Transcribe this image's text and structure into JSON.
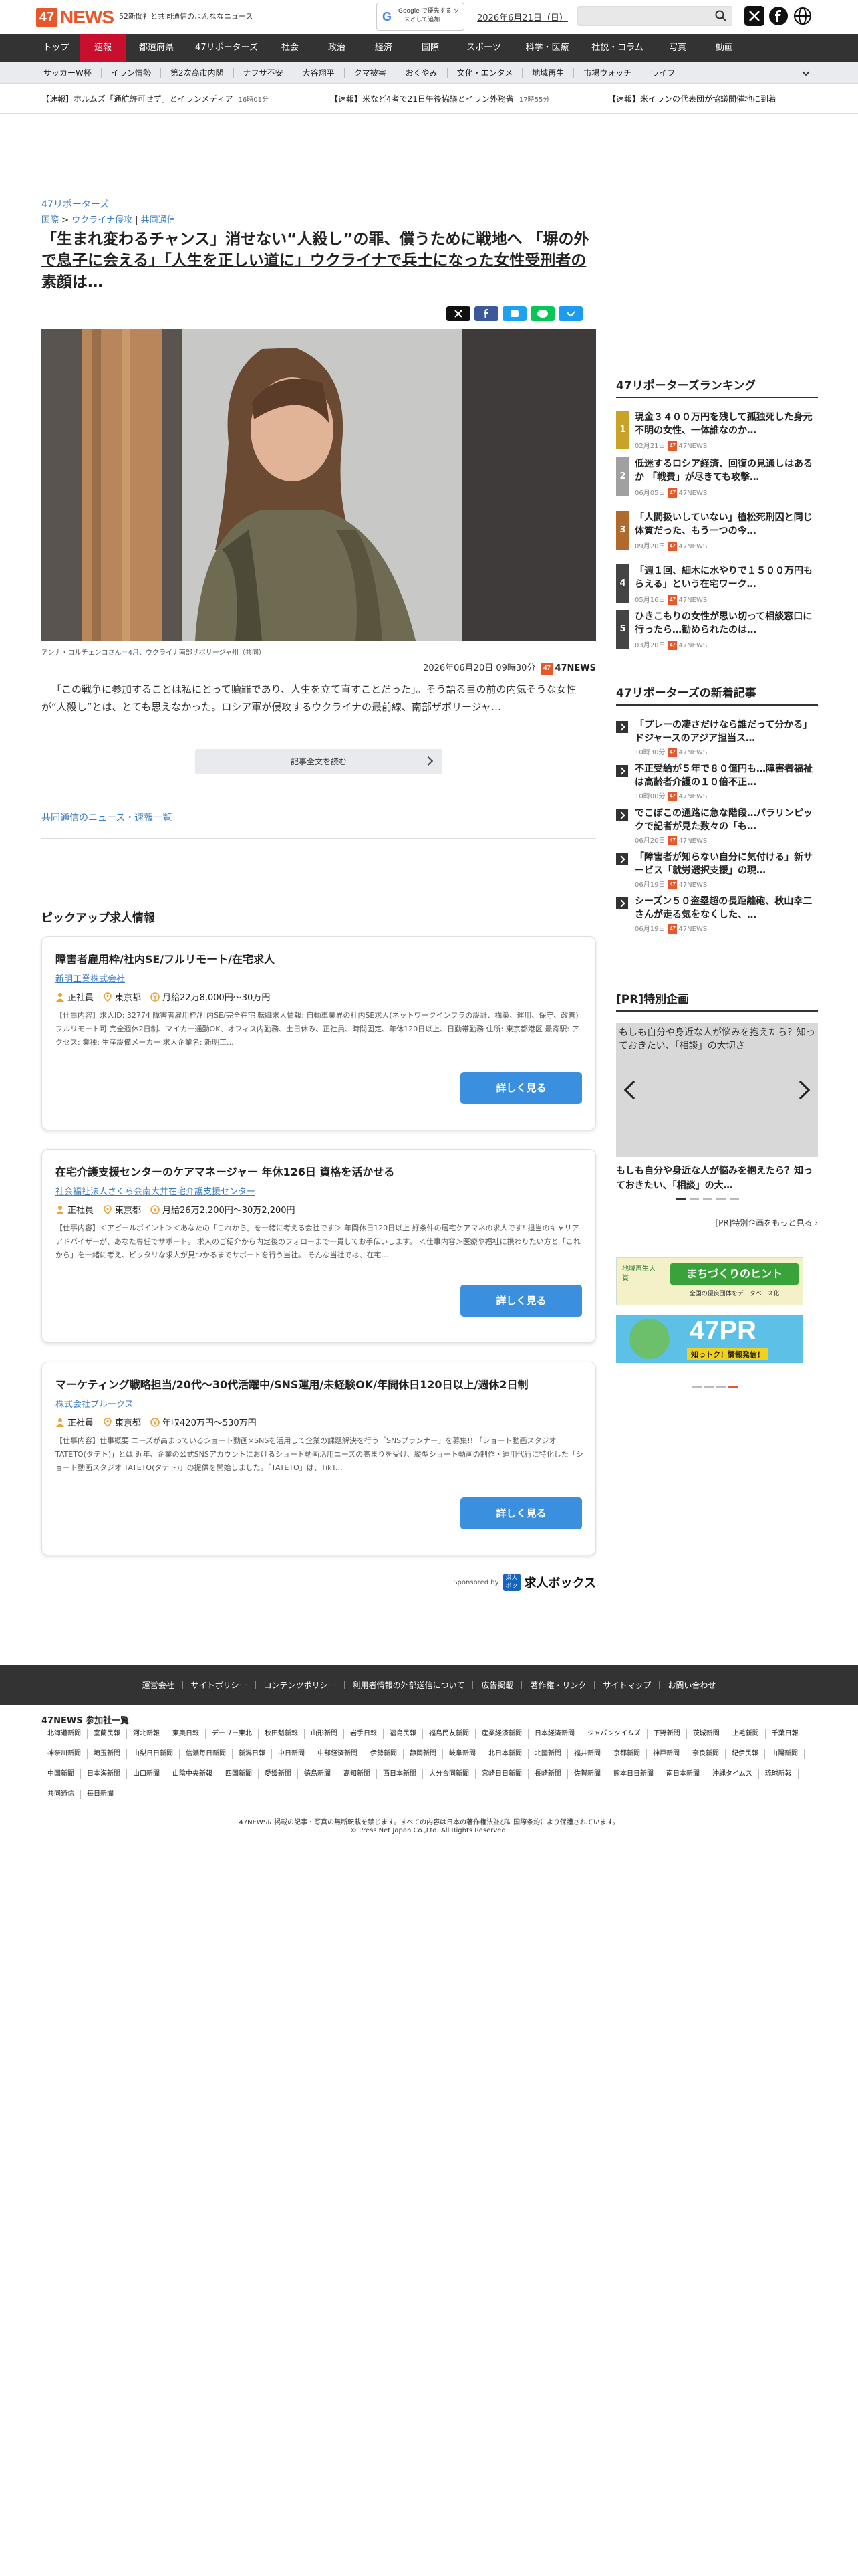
{
  "header": {
    "logo_mark": "47",
    "logo_word": "NEWS",
    "tagline": "52新聞社と共同通信のよんななニュース",
    "google_button": "Google で優先する ソースとして追加",
    "date_link": "2026年6月21日（日）",
    "search_placeholder": ""
  },
  "nav": [
    "トップ",
    "速報",
    "都道府県",
    "47リポーターズ",
    "社会",
    "政治",
    "経済",
    "国際",
    "スポーツ",
    "科学・医療",
    "社説・コラム",
    "写真",
    "動画"
  ],
  "subnav": [
    "サッカーW杯",
    "イラン情勢",
    "第2次高市内閣",
    "ナフサ不安",
    "大谷翔平",
    "クマ被害",
    "おくやみ",
    "文化・エンタメ",
    "地域再生",
    "市場ウォッチ",
    "ライフ"
  ],
  "ticker": [
    {
      "text": "【速報】ホルムズ「通航許可せず」とイランメディア",
      "time": "16時01分"
    },
    {
      "text": "【速報】米など4者で21日午後協議とイラン外務省",
      "time": "17時55分"
    },
    {
      "text": "【速報】米イランの代表団が協議開催地に到着",
      "time": ""
    }
  ],
  "article": {
    "kicker": "47リポーターズ",
    "breadcrumb": [
      "国際",
      "ウクライナ侵攻",
      "共同通信"
    ],
    "headline": "「生まれ変わるチャンス」消せない“人殺し”の罪、償うために戦地へ 「塀の外で息子に会える」「人生を正しい道に」ウクライナで兵士になった女性受刑者の素顔は…",
    "caption": "アンナ・コルチェンコさん＝4月、ウクライナ南部ザポリージャ州（共同）",
    "datetime": "2026年06月20日 09時30分",
    "source_badge": "47",
    "source": "47NEWS",
    "lede": "「この戦争に参加することは私にとって贖罪であり、人生を立て直すことだった」。そう語る目の前の内気そうな女性が“人殺し”とは、とても思えなかった。ロシア軍が侵攻するウクライナの最前線、南部ザポリージャ…",
    "read_more": "記事全文を読む",
    "kyodo_link": "共同通信のニュース・速報一覧"
  },
  "share_colors": [
    "#111111",
    "#3b5998",
    "#1da1f2",
    "#06c755",
    "#1d9bf0"
  ],
  "pickup": {
    "title": "ピックアップ求人情報",
    "jobs": [
      {
        "title": "障害者雇用枠/社内SE/フルリモート/在宅求人",
        "company": "新明工業株式会社",
        "type": "正社員",
        "place": "東京都",
        "pay": "月給22万8,000円〜30万円",
        "desc": "【仕事内容】求人ID: 32774 障害者雇用枠/社内SE/完全在宅 転職求人情報: 自動車業界の社内SE求人(ネットワークインフラの設計、構築、運用、保守、改善) フルリモート可 完全週休2日制、マイカー通勤OK、オフィス内勤務、土日休み、正社員、時間固定、年休120日以上、日勤帯勤務 住所: 東京都港区 最寄駅: アクセス: 業種: 生産設備メーカー 求人企業名: 新明工...",
        "button": "詳しく見る"
      },
      {
        "title": "在宅介護支援センターのケアマネージャー 年休126日 資格を活かせる",
        "company": "社会福祉法人さくら会南大井在宅介護支援センター",
        "type": "正社員",
        "place": "東京都",
        "pay": "月給26万2,200円〜30万2,200円",
        "desc": "【仕事内容】＜アピールポイント＞＜あなたの「これから」を一緒に考える会社です＞ 年間休日120日以上 好条件の居宅ケアマネの求人です! 担当のキャリアアドバイザーが、あなた専任でサポート。 求人のご紹介から内定後のフォローまで一貫してお手伝いします。 ＜仕事内容＞医療や福祉に携わりたい方と「これから」を一緒に考え、ピッタリな求人が見つかるまでサポートを行う当社。 そんな当社では、在宅...",
        "button": "詳しく見る"
      },
      {
        "title": "マーケティング戦略担当/20代〜30代活躍中/SNS運用/未経験OK/年間休日120日以上/週休2日制",
        "company": "株式会社ブルークス",
        "type": "正社員",
        "place": "東京都",
        "pay": "年収420万円〜530万円",
        "desc": "【仕事内容】仕事概要 ニーズが高まっているショート動画×SNSを活用して企業の課題解決を行う「SNSプランナー」を募集!! 「ショート動画スタジオ TATETO(タテト)」とは 近年、企業の公式SNSアカウントにおけるショート動画活用ニーズの高まりを受け、縦型ショート動画の制作・運用代行に特化した「ショート動画スタジオ TATETO(タテト)」の提供を開始しました。「TATETO」は、TikT...",
        "button": "詳しく見る"
      }
    ],
    "sponsored_label": "Sponsored by",
    "sponsor_mark": "求人 ボックス",
    "sponsor_name": "求人ボックス"
  },
  "sidebar": {
    "ranking_title": "47リポーターズランキング",
    "ranking": [
      {
        "num": "1",
        "title": "現金３４００万円を残して孤独死した身元不明の女性、一体誰なのか…",
        "date": "02月21日",
        "src": "47NEWS",
        "color": "#c9a227"
      },
      {
        "num": "2",
        "title": "低迷するロシア経済、回復の見通しはあるか 「戦費」が尽きても攻撃…",
        "date": "06月05日",
        "src": "47NEWS",
        "color": "#a0a0a0"
      },
      {
        "num": "3",
        "title": "「人間扱いしていない」植松死刑囚と同じ体質だった、もう一つの今…",
        "date": "09月20日",
        "src": "47NEWS",
        "color": "#b06a2c"
      },
      {
        "num": "4",
        "title": "「週１回、細木に水やりで１５００万円もらえる」という在宅ワーク…",
        "date": "05月16日",
        "src": "47NEWS",
        "color": "#444444"
      },
      {
        "num": "5",
        "title": "ひきこもりの女性が思い切って相談窓口に行ったら…勧められたのは…",
        "date": "03月20日",
        "src": "47NEWS",
        "color": "#444444"
      }
    ],
    "new_title": "47リポーターズの新着記事",
    "new": [
      {
        "title": "「プレーの凄さだけなら誰だって分かる」ドジャースのアジア担当ス…",
        "date": "10時30分",
        "src": "47NEWS"
      },
      {
        "title": "不正受給が５年で８０億円も…障害者福祉は高齢者介護の１０倍不正…",
        "date": "10時00分",
        "src": "47NEWS"
      },
      {
        "title": "でこぼこの通路に急な階段…パラリンピックで記者が見た数々の「も…",
        "date": "06月20日",
        "src": "47NEWS"
      },
      {
        "title": "「障害者が知らない自分に気付ける」新サービス「就労選択支援」の現…",
        "date": "06月19日",
        "src": "47NEWS"
      },
      {
        "title": "シーズン５０盗塁超の長距離砲、秋山幸二さんが走る気をなくした、…",
        "date": "06月19日",
        "src": "47NEWS"
      }
    ],
    "pr_title": "[PR]特別企画",
    "pr_alt": "もしも自分や身近な人が悩みを抱えたら？知っておきたい、「相談」の大切さ",
    "pr_caption": "もしも自分や身近な人が悩みを抱えたら？知っておきたい、「相談」の大…",
    "pr_more": "[PR]特別企画をもっと見る",
    "banner1_small": "地域再生大賞",
    "banner1": "まちづくりのヒント",
    "banner1_sub": "全国の優良団体をデータベース化",
    "banner2": "47PR",
    "banner2_sub": "知っトク！情報発信！"
  },
  "footer": {
    "links": [
      "運営会社",
      "サイトポリシー",
      "コンテンツポリシー",
      "利用者情報の外部送信について",
      "広告掲載",
      "著作権・リンク",
      "サイトマップ",
      "お問い合わせ"
    ],
    "members_title": "47NEWS 参加社一覧",
    "members": [
      "北海道新聞",
      "室蘭民報",
      "河北新報",
      "東奥日報",
      "デーリー東北",
      "秋田魁新報",
      "山形新聞",
      "岩手日報",
      "福島民報",
      "福島民友新聞",
      "産業経済新聞",
      "日本経済新聞",
      "ジャパンタイムズ",
      "下野新聞",
      "茨城新聞",
      "上毛新聞",
      "千葉日報",
      "神奈川新聞",
      "埼玉新聞",
      "山梨日日新聞",
      "信濃毎日新聞",
      "新潟日報",
      "中日新聞",
      "中部経済新聞",
      "伊勢新聞",
      "静岡新聞",
      "岐阜新聞",
      "北日本新聞",
      "北國新聞",
      "福井新聞",
      "京都新聞",
      "神戸新聞",
      "奈良新聞",
      "紀伊民報",
      "山陽新聞",
      "中国新聞",
      "日本海新聞",
      "山口新聞",
      "山陰中央新報",
      "四国新聞",
      "愛媛新聞",
      "徳島新聞",
      "高知新聞",
      "西日本新聞",
      "大分合同新聞",
      "宮崎日日新聞",
      "長崎新聞",
      "佐賀新聞",
      "熊本日日新聞",
      "南日本新聞",
      "沖縄タイムス",
      "琉球新報",
      "共同通信",
      "毎日新聞"
    ],
    "copyright1": "47NEWSに掲載の記事・写真の無断転載を禁じます。すべての内容は日本の著作権法並びに国際条約により保護されています。",
    "copyright2": "© Press Net Japan Co.,Ltd. All Rights Reserved."
  }
}
